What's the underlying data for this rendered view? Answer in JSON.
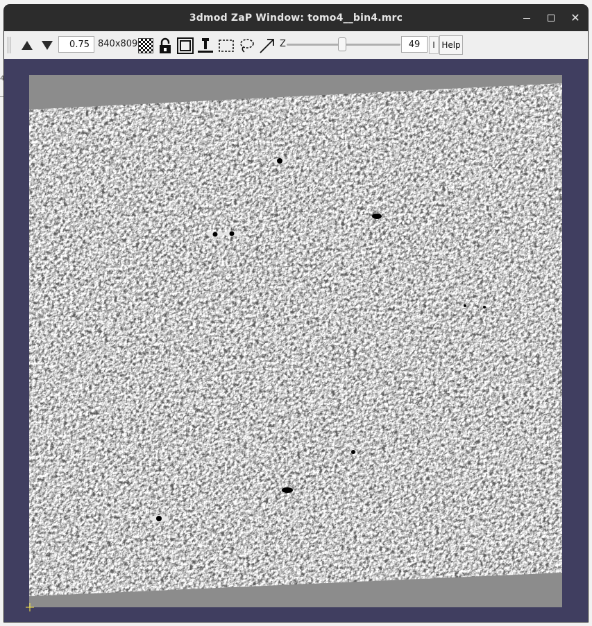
{
  "window": {
    "title": "3dmod ZaP Window: tomo4__bin4.mrc"
  },
  "toolbar": {
    "zoom_value": "0.75",
    "image_size": "840x809",
    "z_label": "Z",
    "section_value": "49",
    "z_slider_fraction": 0.49,
    "info_label": "I",
    "help_label": "Help",
    "icons": [
      "arrow-up-icon",
      "arrow-down-icon",
      "checkerboard-icon",
      "lock-icon",
      "box-outline-icon",
      "pin-icon",
      "rectangle-select-icon",
      "lasso-icon",
      "arrow-draw-icon"
    ]
  },
  "colors": {
    "window_bg": "#403e60",
    "titlebar": "#2c2c2c",
    "toolbar": "#efefef",
    "image_bg": "#8c8c8c"
  }
}
